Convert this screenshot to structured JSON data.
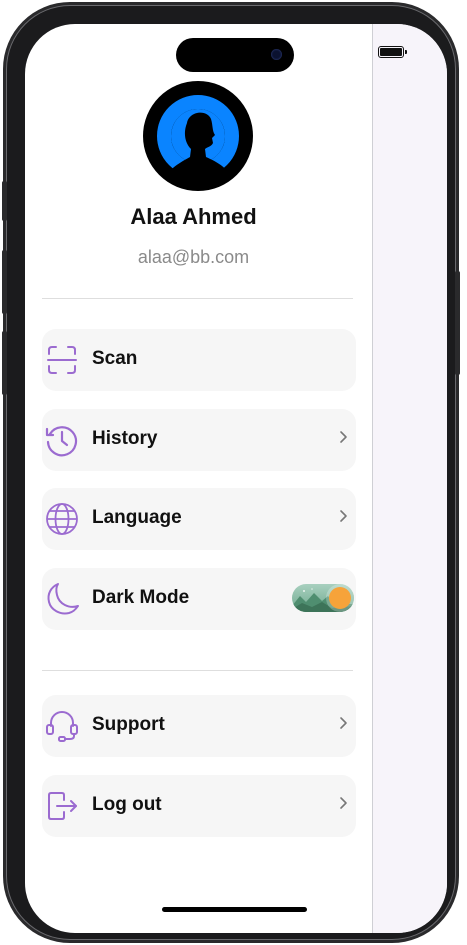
{
  "profile": {
    "name": "Alaa Ahmed",
    "email": "alaa@bb.com",
    "avatar_icon": "person-silhouette-icon",
    "avatar_ring_color": "#0a84ff"
  },
  "menu": {
    "scan": {
      "label": "Scan",
      "icon": "scan-icon"
    },
    "history": {
      "label": "History",
      "icon": "history-icon"
    },
    "language": {
      "label": "Language",
      "icon": "globe-icon"
    },
    "dark_mode": {
      "label": "Dark Mode",
      "icon": "moon-icon",
      "toggle_on": true
    },
    "support": {
      "label": "Support",
      "icon": "headset-icon"
    },
    "logout": {
      "label": "Log out",
      "icon": "logout-icon"
    }
  },
  "colors": {
    "icon_accent": "#9b6bd0",
    "item_background": "#f6f6f6",
    "toggle_knob": "#f6a33a"
  }
}
